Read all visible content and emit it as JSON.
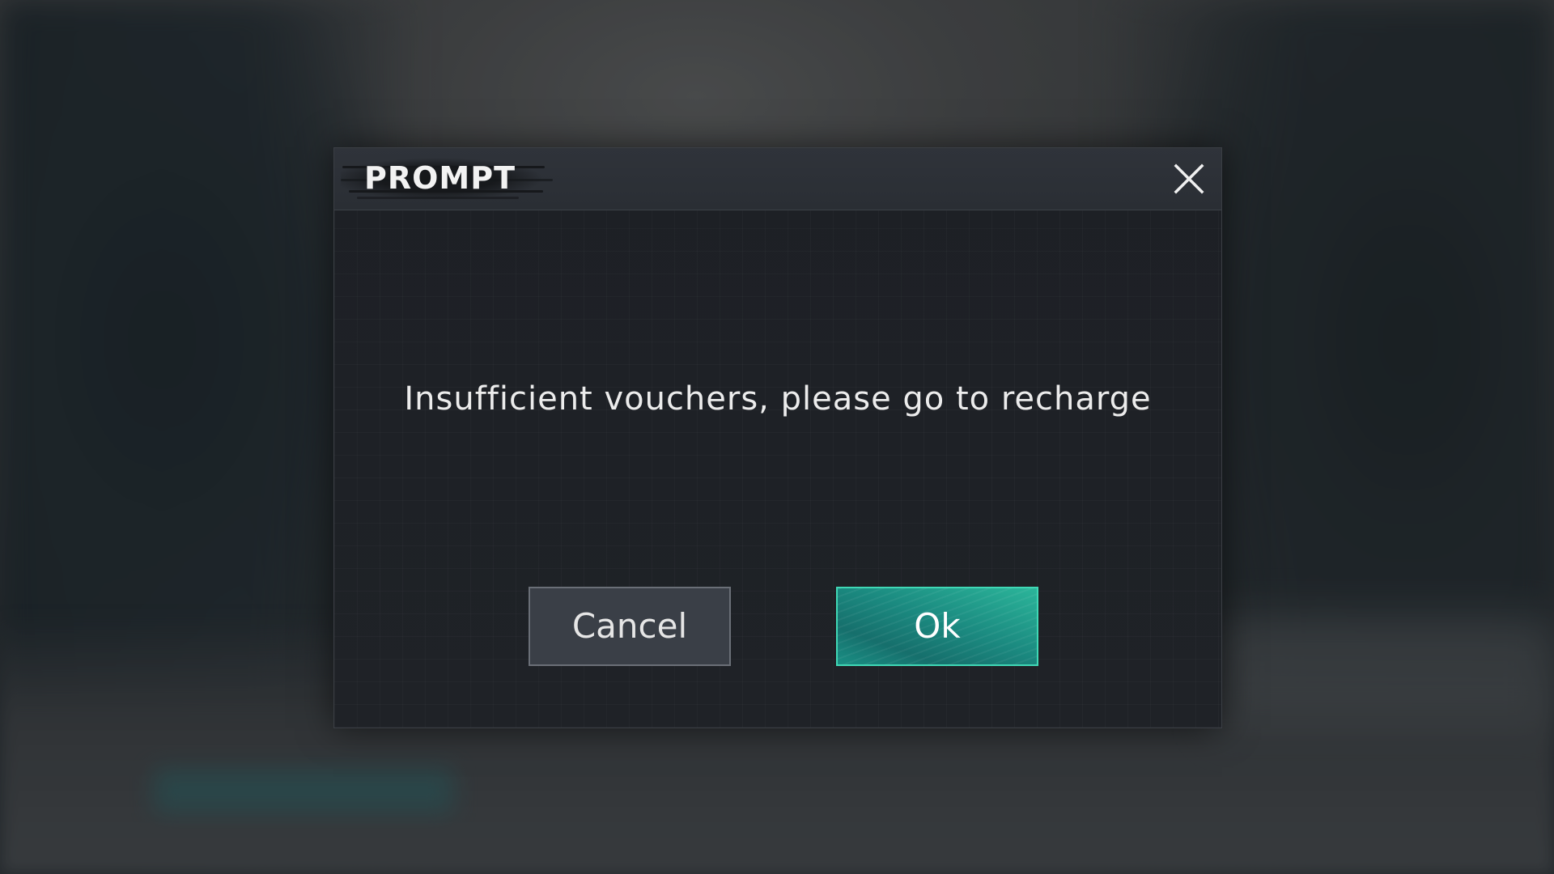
{
  "dialog": {
    "title": "PROMPT",
    "message": "Insufficient vouchers, please go to recharge",
    "close_icon": "close-icon"
  },
  "buttons": {
    "cancel_label": "Cancel",
    "ok_label": "Ok"
  },
  "colors": {
    "ok_accent": "#2bb59a",
    "ok_border": "#3fd8b5",
    "cancel_bg": "#3a3f47",
    "dialog_bg": "#1d2025"
  }
}
